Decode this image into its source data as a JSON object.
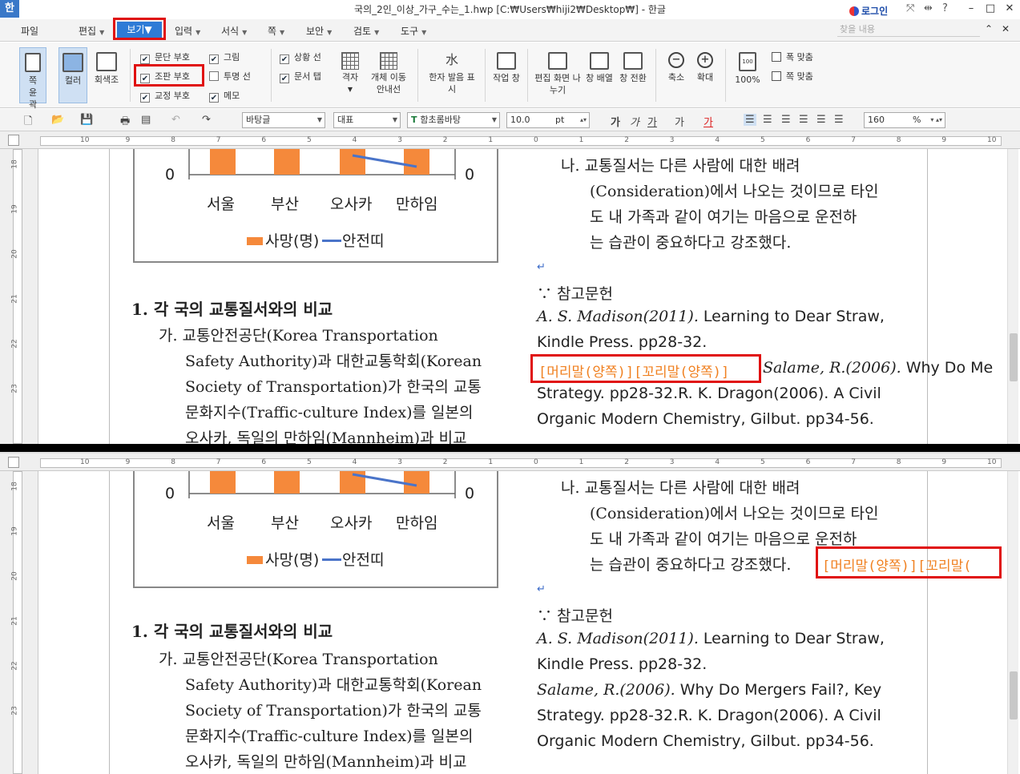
{
  "window": {
    "app_logo": "한",
    "title": "국의_2인_이상_가구_수는_1.hwp [C:₩Users₩hiji2₩Desktop₩] - 한글",
    "login": "로그인",
    "icons": [
      "share-icon",
      "sidebar-icon",
      "help-icon"
    ],
    "help": "?",
    "minimize": "–",
    "maximize": "□",
    "close": "✕"
  },
  "menubar": {
    "items": [
      "파일",
      "편집",
      "보기",
      "입력",
      "서식",
      "쪽",
      "보안",
      "검토",
      "도구"
    ],
    "active": "보기",
    "search_placeholder": "찾을 내용"
  },
  "ribbon": {
    "page_outline": "쪽 윤곽",
    "color": "컬러",
    "grayscale": "회색조",
    "checks": [
      {
        "label": "문단 부호",
        "checked": true
      },
      {
        "label": "조판 부호",
        "checked": true
      },
      {
        "label": "교정 부호",
        "checked": true
      },
      {
        "label": "그림",
        "checked": true
      },
      {
        "label": "투명 선",
        "checked": false
      },
      {
        "label": "메모",
        "checked": true
      },
      {
        "label": "상황 선",
        "checked": true
      },
      {
        "label": "문서 탭",
        "checked": true
      }
    ],
    "grid": "격자",
    "object_guide": "개체 이동 안내선",
    "hanja": "한자 발음 표시",
    "task_pane": "작업 창",
    "split_view": "편집 화면 나누기",
    "window_arrange": "창 배열",
    "window_switch": "창 전환",
    "zoom_out": "축소",
    "zoom_in": "확대",
    "zoom_level": "100%",
    "fit_width": "폭 맞춤",
    "fit_page": "쪽 맞춤"
  },
  "format": {
    "style": "바탕글",
    "lang": "대표",
    "font": "함초롬바탕",
    "size": "10.0",
    "unit": "pt",
    "zoom": "160",
    "zoom_unit": "%"
  },
  "ruler": {
    "numbers": [
      "10",
      "9",
      "8",
      "7",
      "6",
      "5",
      "4",
      "3",
      "2",
      "1",
      "0",
      "1",
      "2",
      "3",
      "4",
      "5",
      "6",
      "7",
      "8",
      "9",
      "10"
    ],
    "vnumbers": [
      "18",
      "19",
      "20",
      "21",
      "22",
      "23"
    ]
  },
  "chart_data": {
    "type": "bar",
    "categories": [
      "서울",
      "부산",
      "오사카",
      "만하임"
    ],
    "series": [
      {
        "name": "사망(명)",
        "type": "bar"
      },
      {
        "name": "안전띠",
        "type": "line"
      }
    ],
    "axis_left_label": "0",
    "axis_right_label": "0"
  },
  "doc": {
    "heading": "1. 각 국의 교통질서와의 비교",
    "left_lines": [
      "가. 교통안전공단(Korea        Transportation",
      "Safety Authority)과 대한교통학회(Korean",
      "Society of Transportation)가 한국의 교통",
      "문화지수(Traffic-culture Index)를 일본의",
      "오사카, 독일의 만하임(Mannheim)과 비교"
    ],
    "right_top_lines": [
      "나. 교통질서는   다른   사람에   대한   배려",
      "(Consideration)에서 나오는 것이므로 타인",
      "도 내 가족과 같이 여기는 마음으로 운전하"
    ],
    "right_top_last": "는 습관이 중요하다고 강조했다.",
    "ref_title": "∵ 참고문헌",
    "ref1_italic": "A. S. Madison(2011).",
    "ref1_rest": " Learning to Dear Straw,",
    "ref1_line2": "Kindle Press. pp28-32.",
    "ref2_italic": "Salame, R.(2006).",
    "ref2_rest": " Why Do Mergers Fail?, Key",
    "ref2_rest_cut": " Why Do Me",
    "ref2_line2": "Strategy. pp28-32.R. K. Dragon(2006). A Civil",
    "ref2_line3": "Organic Modern Chemistry, Gilbut. pp34-56.",
    "codes": "[머리말(양쪽)][꼬리말(양쪽)]",
    "codes_cut": "[머리말(양쪽)][꼬리말("
  }
}
